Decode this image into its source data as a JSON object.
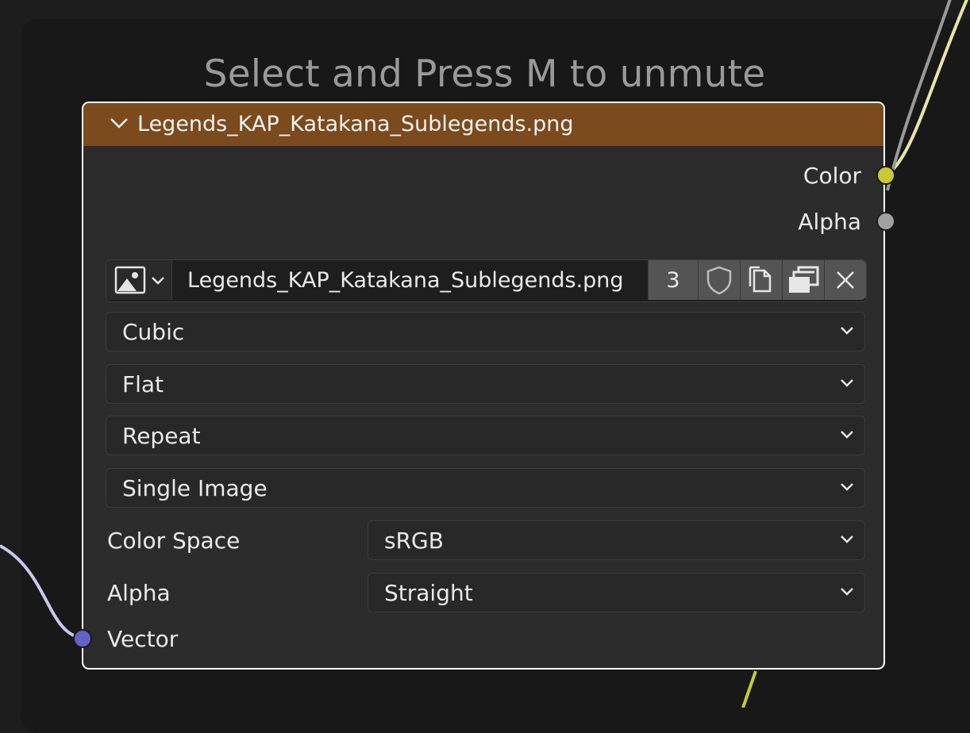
{
  "hint": "Select and Press M to unmute",
  "node": {
    "title": "Legends_KAP_Katakana_Sublegends.png",
    "header_color": "#7b4a1d",
    "outputs": [
      {
        "label": "Color",
        "socket_color": "#c9c935"
      },
      {
        "label": "Alpha",
        "socket_color": "#a1a1a1"
      }
    ],
    "image": {
      "type_icon": "image-icon",
      "name": "Legends_KAP_Katakana_Sublegends.png",
      "users": "3",
      "buttons": [
        "fake-user-icon",
        "duplicate-icon",
        "open-icon",
        "close-icon"
      ]
    },
    "interpolation": "Cubic",
    "projection": "Flat",
    "extension": "Repeat",
    "source": "Single Image",
    "color_space": {
      "label": "Color Space",
      "value": "sRGB"
    },
    "alpha_mode": {
      "label": "Alpha",
      "value": "Straight"
    },
    "input": {
      "label": "Vector",
      "socket_color": "#6363c7"
    }
  }
}
